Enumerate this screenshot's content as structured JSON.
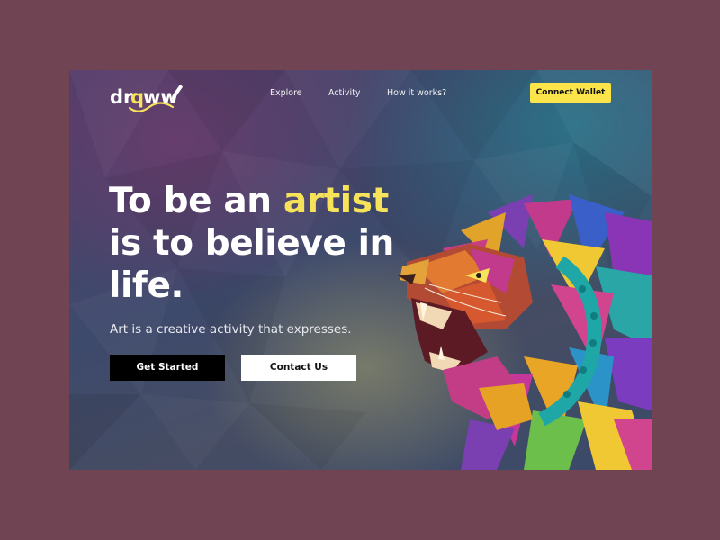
{
  "brand": {
    "logo_text": "drqww",
    "colors": {
      "accent": "#fbe54a",
      "page_background": "#714453",
      "primary_button": "#000000",
      "secondary_button": "#ffffff"
    }
  },
  "nav": {
    "links": [
      {
        "label": "Explore"
      },
      {
        "label": "Activity"
      },
      {
        "label": "How it works?"
      }
    ],
    "cta_label": "Connect Wallet"
  },
  "hero": {
    "headline_part1": "To be an ",
    "headline_accent": "artist",
    "headline_part2": "is to believe in life.",
    "subtitle": "Art is a creative activity that expresses.",
    "primary_button": "Get Started",
    "secondary_button": "Contact Us"
  },
  "icons": {
    "logo_icon": "pencil-icon",
    "hero_art": "colorful-lion-illustration"
  }
}
